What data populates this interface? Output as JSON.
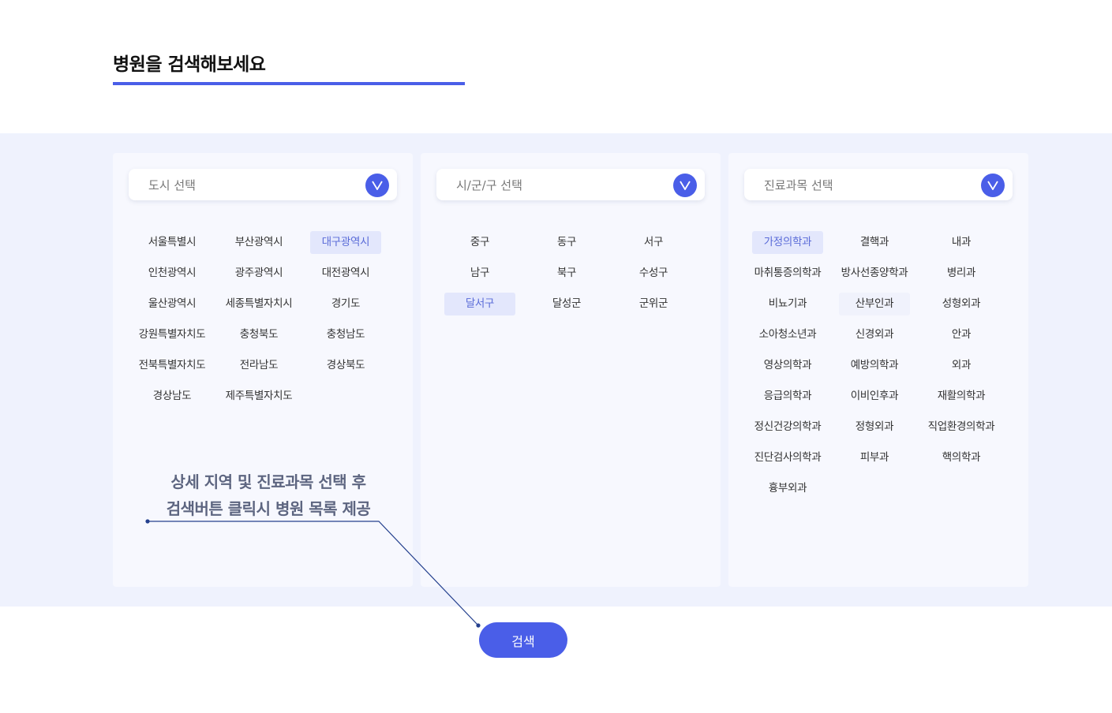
{
  "page": {
    "title": "병원을 검색해보세요",
    "accent_color": "#4a5ee8"
  },
  "city": {
    "placeholder": "도시 선택",
    "options": [
      "서울특별시",
      "부산광역시",
      "대구광역시",
      "인천광역시",
      "광주광역시",
      "대전광역시",
      "울산광역시",
      "세종특별자치시",
      "경기도",
      "강원특별자치도",
      "충청북도",
      "충청남도",
      "전북특별자치도",
      "전라남도",
      "경상북도",
      "경상남도",
      "제주특별자치도"
    ],
    "selected": "대구광역시"
  },
  "district": {
    "placeholder": "시/군/구 선택",
    "options": [
      "중구",
      "동구",
      "서구",
      "남구",
      "북구",
      "수성구",
      "달서구",
      "달성군",
      "군위군"
    ],
    "selected": "달서구"
  },
  "department": {
    "placeholder": "진료과목 선택",
    "options": [
      "가정의학과",
      "결핵과",
      "내과",
      "마취통증의학과",
      "방사선종양학과",
      "병리과",
      "비뇨기과",
      "산부인과",
      "성형외과",
      "소아청소년과",
      "신경외과",
      "안과",
      "영상의학과",
      "예방의학과",
      "외과",
      "응급의학과",
      "이비인후과",
      "재활의학과",
      "정신건강의학과",
      "정형외과",
      "직업환경의학과",
      "진단검사의학과",
      "피부과",
      "핵의학과",
      "흉부외과"
    ],
    "selected": "가정의학과",
    "hovered": "산부인과"
  },
  "note": {
    "line1": "상세 지역 및 진료과목 선택 후",
    "line2": "검색버튼 클릭시 병원 목록 제공"
  },
  "search_button": {
    "label": "검색"
  },
  "icons": {
    "dropdown": "chevron-down-icon"
  }
}
